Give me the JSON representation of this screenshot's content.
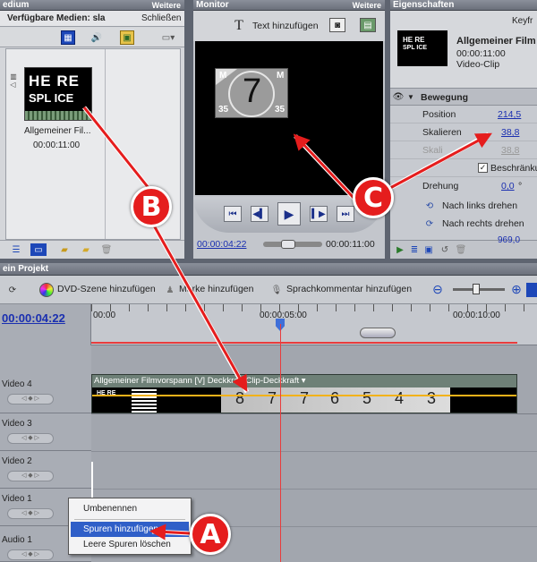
{
  "media": {
    "title": "edium",
    "more": "Weitere",
    "toolbar_label": "Verfügbare Medien: sla",
    "close_label": "Schließen",
    "clip_thumb_text_top": "HE RE",
    "clip_thumb_text_bottom": "SPL ICE",
    "clip_name": "Allgemeiner Fil...",
    "clip_duration": "00:00:11:00"
  },
  "monitor": {
    "title": "Monitor",
    "more": "Weitere",
    "add_text_label": "Text hinzufügen",
    "countdown_number": "7",
    "corner_tl": "M",
    "corner_tr": "M",
    "corner_bl": "35",
    "corner_br": "35",
    "time_current": "00:00:04:22",
    "time_total": "00:00:11:00"
  },
  "properties": {
    "title": "Eigenschaften",
    "keyframes": "Keyfr",
    "clip_title": "Allgemeiner Film",
    "clip_duration": "00:00:11:00",
    "clip_type": "Video-Clip",
    "thumb_top": "HE RE",
    "thumb_bottom": "SPL ICE",
    "section": "Bewegung",
    "position_label": "Position",
    "position_value": "214,5",
    "scale_label": "Skalieren",
    "scale_value": "38,8",
    "scale2_label": "Skali",
    "scale2_value": "38,8",
    "constrain_label": "Beschränku",
    "rotation_label": "Drehung",
    "rotation_value": "0,0",
    "rotate_left": "Nach links drehen",
    "rotate_right": "Nach rechts drehen",
    "bottom_partial": "969,0"
  },
  "project": {
    "title": "ein Projekt",
    "dvd_scene": "DVD-Szene hinzufügen",
    "marker": "Marke hinzufügen",
    "voice": "Sprachkommentar hinzufügen",
    "timecode": "00:00:04:22",
    "ruler": [
      "00:00",
      "00:00:05:00",
      "00:00:10:00"
    ],
    "clip_label": "Allgemeiner Filmvorspann [V] Deckkraft:Clip-Deckkraft",
    "countdown_frames": [
      "8",
      "7",
      "7",
      "6",
      "5",
      "4",
      "3"
    ],
    "tracks": [
      "Video 4",
      "Video 3",
      "Video 2",
      "Video 1",
      "Audio 1"
    ]
  },
  "context_menu": {
    "items": [
      "Umbenennen",
      "Spuren hinzufügen...",
      "Leere Spuren löschen"
    ]
  },
  "callouts": [
    "A",
    "B",
    "C"
  ],
  "colors": {
    "accent": "#e51d1d",
    "selection": "#2f5fc8",
    "playhead": "#e83c3c",
    "link": "#1a2fb0"
  }
}
